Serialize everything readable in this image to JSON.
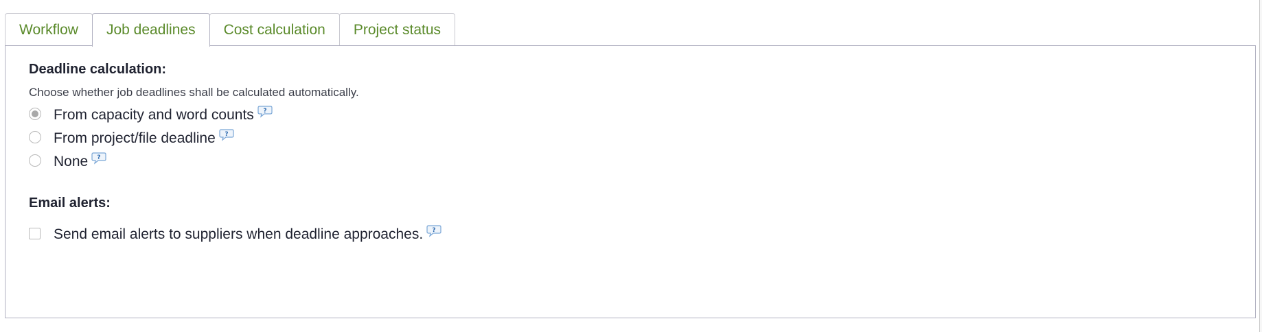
{
  "tabs": [
    {
      "label": "Workflow",
      "active": false
    },
    {
      "label": "Job deadlines",
      "active": true
    },
    {
      "label": "Cost calculation",
      "active": false
    },
    {
      "label": "Project status",
      "active": false
    }
  ],
  "deadline": {
    "title": "Deadline calculation:",
    "description": "Choose whether job deadlines shall be calculated automatically.",
    "options": [
      {
        "label": "From capacity and word counts",
        "selected": true
      },
      {
        "label": "From project/file deadline",
        "selected": false
      },
      {
        "label": "None",
        "selected": false
      }
    ]
  },
  "email": {
    "title": "Email alerts:",
    "checkbox_label": "Send email alerts to suppliers when deadline approaches.",
    "checked": false
  },
  "colors": {
    "tab_text": "#5a8a2a",
    "help_icon": "#4a86c8"
  },
  "icons": {
    "help": "help-bubble-icon"
  }
}
